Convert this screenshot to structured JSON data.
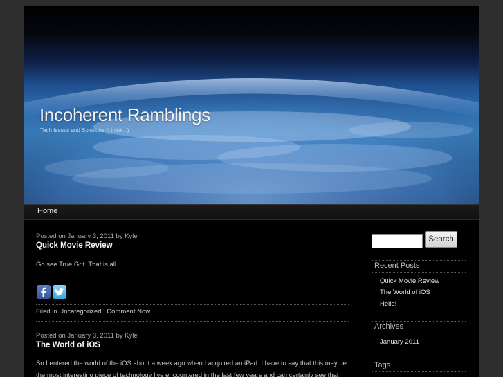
{
  "site": {
    "title": "Incoherent Ramblings",
    "description": "Tech Issues and Solutions (I think...)"
  },
  "nav": {
    "home": "Home"
  },
  "posts": [
    {
      "meta": "Posted on January 3, 2011 by Kyle",
      "title": "Quick Movie Review",
      "body": "Go see True Grit.  That is all.",
      "filed_in": "Filed in",
      "category": "Uncategorized",
      "separator": "|",
      "comment": "Comment Now"
    },
    {
      "meta": "Posted on January 3, 2011 by Kyle",
      "title": "The World of iOS",
      "body": "So I entered the world of the iOS about a week ago when I acquired an iPad.  I have to say that this may be the most interesting piece of technology I've encountered in the last few years and can certainly see that"
    }
  ],
  "sidebar": {
    "search_button": "Search",
    "recent_posts": {
      "heading": "Recent Posts",
      "items": [
        "Quick Movie Review",
        "The World of iOS",
        "Hello!"
      ]
    },
    "archives": {
      "heading": "Archives",
      "items": [
        "January 2011"
      ]
    },
    "tags": {
      "heading": "Tags"
    }
  },
  "colors": {
    "page_bg": "#2e2e2e",
    "content_bg": "#000000",
    "facebook": "#3b5998",
    "twitter": "#33a7e0"
  },
  "icons": {
    "facebook": "facebook-icon",
    "twitter": "twitter-icon"
  }
}
